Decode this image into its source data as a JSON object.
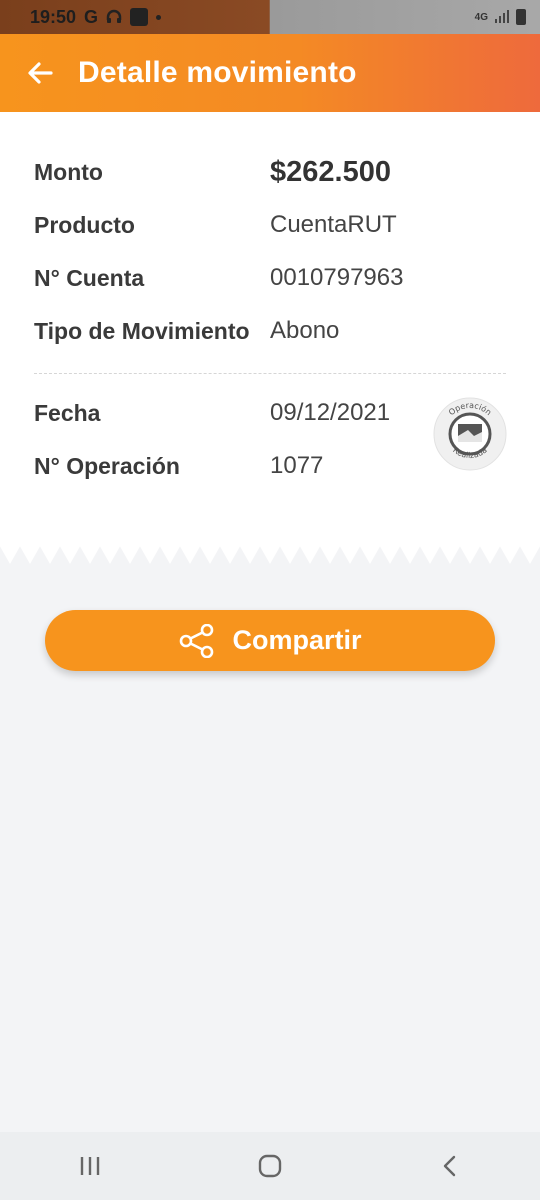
{
  "status_bar": {
    "time": "19:50",
    "icons": [
      "google-icon",
      "headphones-icon",
      "app-notification-icon",
      "dot-icon"
    ],
    "network": "4G",
    "right_icons": [
      "signal-icon",
      "battery-icon"
    ]
  },
  "app_bar": {
    "title": "Detalle movimiento",
    "back_icon": "arrow-left-icon"
  },
  "details": [
    {
      "label": "Monto",
      "value": "$262.500"
    },
    {
      "label": "Producto",
      "value": "CuentaRUT"
    },
    {
      "label": "N° Cuenta",
      "value": "0010797963"
    },
    {
      "label": "Tipo de Movimiento",
      "value": "Abono"
    }
  ],
  "details_secondary": [
    {
      "label": "Fecha",
      "value": "09/12/2021"
    },
    {
      "label": "N° Operación",
      "value": "1077"
    }
  ],
  "stamp": {
    "top_text": "Operación",
    "bottom_text": "Realizada"
  },
  "share_button": {
    "label": "Compartir",
    "icon": "share-icon"
  },
  "nav_bar": {
    "items": [
      "recent-apps-icon",
      "home-icon",
      "back-icon"
    ]
  },
  "colors": {
    "accent": "#f7941d",
    "accent_end": "#ee6a3c",
    "background": "#f3f4f6"
  }
}
